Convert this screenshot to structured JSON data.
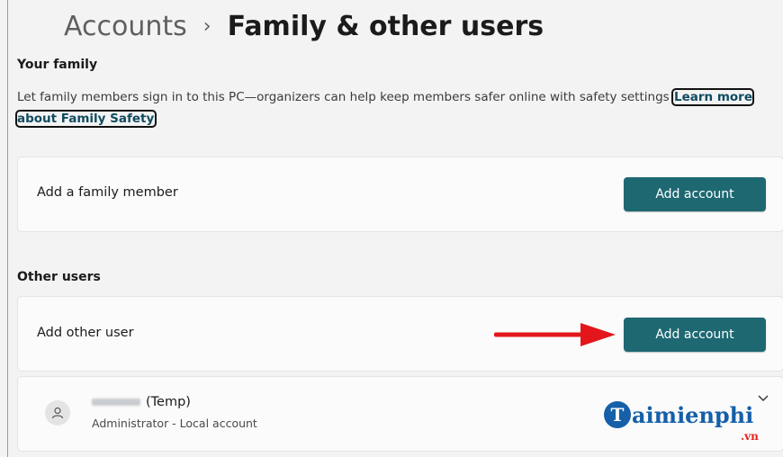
{
  "breadcrumb": {
    "parent": "Accounts",
    "separator": "›",
    "current": "Family & other users"
  },
  "family": {
    "title": "Your family",
    "description": "Let family members sign in to this PC—organizers can help keep members safer online with safety settings",
    "learn_link": "Learn more about Family Safety",
    "add_member_label": "Add a family member",
    "add_button": "Add account"
  },
  "other_users": {
    "title": "Other users",
    "add_other_label": "Add other user",
    "add_button": "Add account",
    "users": [
      {
        "name_suffix": "(Temp)",
        "subtitle": "Administrator - Local account",
        "avatar_icon": "person-icon"
      }
    ]
  },
  "annotation": {
    "icon": "red-arrow-icon",
    "color": "#e3171b"
  },
  "watermark": {
    "logo_text": "Taimienphi.vn"
  },
  "colors": {
    "accent": "#1e6872",
    "link": "#0f4b60",
    "background": "#f3f3f3",
    "card": "#fbfbfb"
  }
}
